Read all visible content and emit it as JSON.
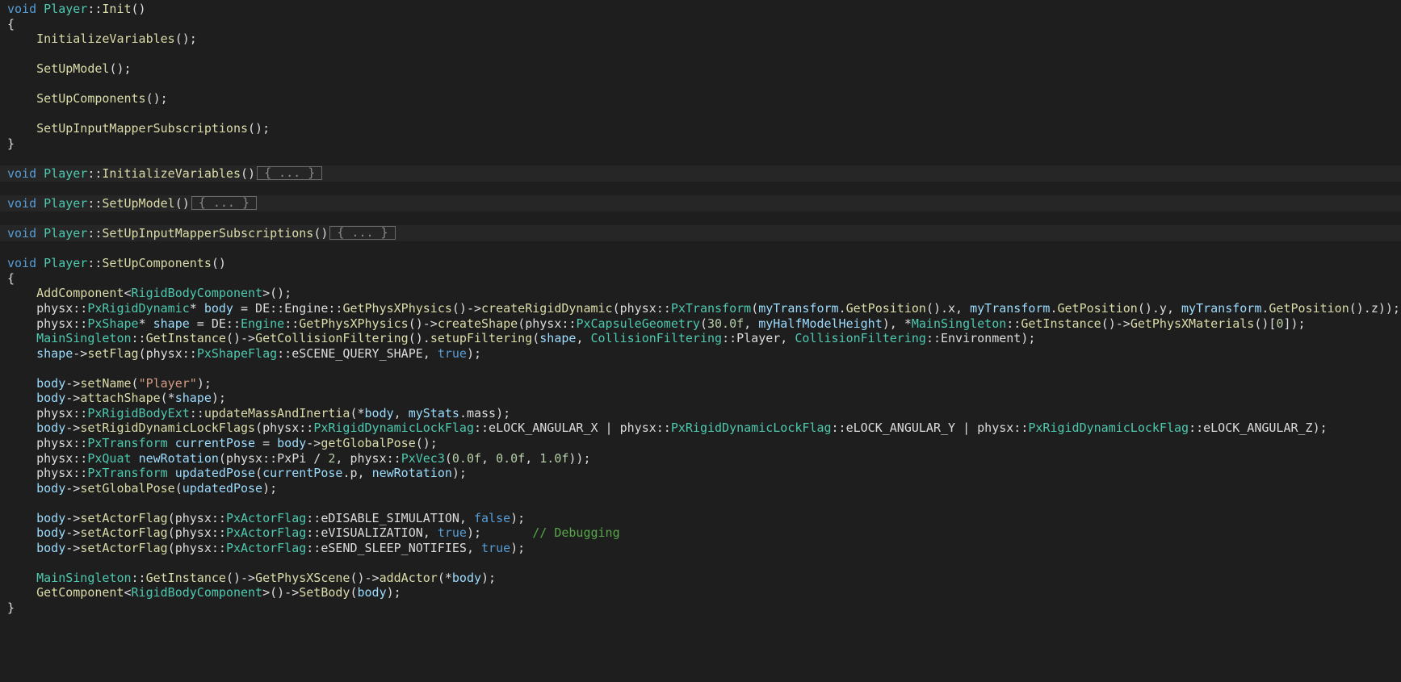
{
  "colors": {
    "background": "#1e1e1e",
    "keyword": "#569cd6",
    "type": "#4ec9b0",
    "function": "#dcdcaa",
    "plain": "#dcdcdc",
    "variable": "#9cdcfe",
    "number": "#b5cea8",
    "string": "#d69d85",
    "comment": "#57a64a"
  },
  "lines": [
    {
      "tokens": [
        [
          "kw",
          "void"
        ],
        [
          "pl",
          " "
        ],
        [
          "ty",
          "Player"
        ],
        [
          "pl",
          "::"
        ],
        [
          "fn",
          "Init"
        ],
        [
          "pl",
          "()"
        ]
      ]
    },
    {
      "tokens": [
        [
          "pl",
          "{"
        ]
      ]
    },
    {
      "tokens": [
        [
          "pl",
          "    "
        ],
        [
          "fn",
          "InitializeVariables"
        ],
        [
          "pl",
          "();"
        ]
      ]
    },
    {
      "tokens": []
    },
    {
      "tokens": [
        [
          "pl",
          "    "
        ],
        [
          "fn",
          "SetUpModel"
        ],
        [
          "pl",
          "();"
        ]
      ]
    },
    {
      "tokens": []
    },
    {
      "tokens": [
        [
          "pl",
          "    "
        ],
        [
          "fn",
          "SetUpComponents"
        ],
        [
          "pl",
          "();"
        ]
      ]
    },
    {
      "tokens": []
    },
    {
      "tokens": [
        [
          "pl",
          "    "
        ],
        [
          "fn",
          "SetUpInputMapperSubscriptions"
        ],
        [
          "pl",
          "();"
        ]
      ]
    },
    {
      "tokens": [
        [
          "pl",
          "}"
        ]
      ]
    },
    {
      "tokens": []
    },
    {
      "highlight": true,
      "fold": "{ ... }",
      "tokens": [
        [
          "kw",
          "void"
        ],
        [
          "pl",
          " "
        ],
        [
          "ty",
          "Player"
        ],
        [
          "pl",
          "::"
        ],
        [
          "fn",
          "InitializeVariables"
        ],
        [
          "pl",
          "()"
        ]
      ]
    },
    {
      "tokens": []
    },
    {
      "highlight": true,
      "fold": "{ ... }",
      "tokens": [
        [
          "kw",
          "void"
        ],
        [
          "pl",
          " "
        ],
        [
          "ty",
          "Player"
        ],
        [
          "pl",
          "::"
        ],
        [
          "fn",
          "SetUpModel"
        ],
        [
          "pl",
          "()"
        ]
      ]
    },
    {
      "tokens": []
    },
    {
      "highlight": true,
      "fold": "{ ... }",
      "tokens": [
        [
          "kw",
          "void"
        ],
        [
          "pl",
          " "
        ],
        [
          "ty",
          "Player"
        ],
        [
          "pl",
          "::"
        ],
        [
          "fn",
          "SetUpInputMapperSubscriptions"
        ],
        [
          "pl",
          "()"
        ]
      ]
    },
    {
      "tokens": []
    },
    {
      "tokens": [
        [
          "kw",
          "void"
        ],
        [
          "pl",
          " "
        ],
        [
          "ty",
          "Player"
        ],
        [
          "pl",
          "::"
        ],
        [
          "fn",
          "SetUpComponents"
        ],
        [
          "pl",
          "()"
        ]
      ]
    },
    {
      "tokens": [
        [
          "pl",
          "{"
        ]
      ]
    },
    {
      "tokens": [
        [
          "pl",
          "    "
        ],
        [
          "fn",
          "AddComponent"
        ],
        [
          "pl",
          "<"
        ],
        [
          "ty",
          "RigidBodyComponent"
        ],
        [
          "pl",
          ">();"
        ]
      ]
    },
    {
      "tokens": [
        [
          "pl",
          "    physx::"
        ],
        [
          "ty",
          "PxRigidDynamic"
        ],
        [
          "pl",
          "* "
        ],
        [
          "var",
          "body"
        ],
        [
          "pl",
          " = DE::Engine::"
        ],
        [
          "fn",
          "GetPhysXPhysics"
        ],
        [
          "pl",
          "()->"
        ],
        [
          "fn",
          "createRigidDynamic"
        ],
        [
          "pl",
          "(physx::"
        ],
        [
          "ty",
          "PxTransform"
        ],
        [
          "pl",
          "("
        ],
        [
          "var",
          "myTransform"
        ],
        [
          "pl",
          "."
        ],
        [
          "fn",
          "GetPosition"
        ],
        [
          "pl",
          "().x, "
        ],
        [
          "var",
          "myTransform"
        ],
        [
          "pl",
          "."
        ],
        [
          "fn",
          "GetPosition"
        ],
        [
          "pl",
          "().y, "
        ],
        [
          "var",
          "myTransform"
        ],
        [
          "pl",
          "."
        ],
        [
          "fn",
          "GetPosition"
        ],
        [
          "pl",
          "().z));"
        ]
      ]
    },
    {
      "tokens": [
        [
          "pl",
          "    physx::"
        ],
        [
          "ty",
          "PxShape"
        ],
        [
          "pl",
          "* "
        ],
        [
          "var",
          "shape"
        ],
        [
          "pl",
          " = DE::"
        ],
        [
          "ty",
          "Engine"
        ],
        [
          "pl",
          "::"
        ],
        [
          "fn",
          "GetPhysXPhysics"
        ],
        [
          "pl",
          "()->"
        ],
        [
          "fn",
          "createShape"
        ],
        [
          "pl",
          "(physx::"
        ],
        [
          "ty",
          "PxCapsuleGeometry"
        ],
        [
          "pl",
          "("
        ],
        [
          "num",
          "30.0f"
        ],
        [
          "pl",
          ", "
        ],
        [
          "var",
          "myHalfModelHeight"
        ],
        [
          "pl",
          "), *"
        ],
        [
          "ty",
          "MainSingleton"
        ],
        [
          "pl",
          "::"
        ],
        [
          "fn",
          "GetInstance"
        ],
        [
          "pl",
          "()->"
        ],
        [
          "fn",
          "GetPhysXMaterials"
        ],
        [
          "pl",
          "()["
        ],
        [
          "num",
          "0"
        ],
        [
          "pl",
          "]);"
        ]
      ]
    },
    {
      "tokens": [
        [
          "pl",
          "    "
        ],
        [
          "ty",
          "MainSingleton"
        ],
        [
          "pl",
          "::"
        ],
        [
          "fn",
          "GetInstance"
        ],
        [
          "pl",
          "()->"
        ],
        [
          "fn",
          "GetCollisionFiltering"
        ],
        [
          "pl",
          "()."
        ],
        [
          "fn",
          "setupFiltering"
        ],
        [
          "pl",
          "("
        ],
        [
          "var",
          "shape"
        ],
        [
          "pl",
          ", "
        ],
        [
          "ty",
          "CollisionFiltering"
        ],
        [
          "pl",
          "::Player, "
        ],
        [
          "ty",
          "CollisionFiltering"
        ],
        [
          "pl",
          "::Environment);"
        ]
      ]
    },
    {
      "tokens": [
        [
          "pl",
          "    "
        ],
        [
          "var",
          "shape"
        ],
        [
          "pl",
          "->"
        ],
        [
          "fn",
          "setFlag"
        ],
        [
          "pl",
          "(physx::"
        ],
        [
          "ty",
          "PxShapeFlag"
        ],
        [
          "pl",
          "::eSCENE_QUERY_SHAPE, "
        ],
        [
          "kw",
          "true"
        ],
        [
          "pl",
          ");"
        ]
      ]
    },
    {
      "tokens": []
    },
    {
      "tokens": [
        [
          "pl",
          "    "
        ],
        [
          "var",
          "body"
        ],
        [
          "pl",
          "->"
        ],
        [
          "fn",
          "setName"
        ],
        [
          "pl",
          "("
        ],
        [
          "str",
          "\"Player\""
        ],
        [
          "pl",
          ");"
        ]
      ]
    },
    {
      "tokens": [
        [
          "pl",
          "    "
        ],
        [
          "var",
          "body"
        ],
        [
          "pl",
          "->"
        ],
        [
          "fn",
          "attachShape"
        ],
        [
          "pl",
          "(*"
        ],
        [
          "var",
          "shape"
        ],
        [
          "pl",
          ");"
        ]
      ]
    },
    {
      "tokens": [
        [
          "pl",
          "    physx::"
        ],
        [
          "ty",
          "PxRigidBodyExt"
        ],
        [
          "pl",
          "::"
        ],
        [
          "fn",
          "updateMassAndInertia"
        ],
        [
          "pl",
          "(*"
        ],
        [
          "var",
          "body"
        ],
        [
          "pl",
          ", "
        ],
        [
          "var",
          "myStats"
        ],
        [
          "pl",
          ".mass);"
        ]
      ]
    },
    {
      "tokens": [
        [
          "pl",
          "    "
        ],
        [
          "var",
          "body"
        ],
        [
          "pl",
          "->"
        ],
        [
          "fn",
          "setRigidDynamicLockFlags"
        ],
        [
          "pl",
          "(physx::"
        ],
        [
          "ty",
          "PxRigidDynamicLockFlag"
        ],
        [
          "pl",
          "::eLOCK_ANGULAR_X | physx::"
        ],
        [
          "ty",
          "PxRigidDynamicLockFlag"
        ],
        [
          "pl",
          "::eLOCK_ANGULAR_Y | physx::"
        ],
        [
          "ty",
          "PxRigidDynamicLockFlag"
        ],
        [
          "pl",
          "::eLOCK_ANGULAR_Z);"
        ]
      ]
    },
    {
      "tokens": [
        [
          "pl",
          "    physx::"
        ],
        [
          "ty",
          "PxTransform"
        ],
        [
          "pl",
          " "
        ],
        [
          "var",
          "currentPose"
        ],
        [
          "pl",
          " = "
        ],
        [
          "var",
          "body"
        ],
        [
          "pl",
          "->"
        ],
        [
          "fn",
          "getGlobalPose"
        ],
        [
          "pl",
          "();"
        ]
      ]
    },
    {
      "tokens": [
        [
          "pl",
          "    physx::"
        ],
        [
          "ty",
          "PxQuat"
        ],
        [
          "pl",
          " "
        ],
        [
          "var",
          "newRotation"
        ],
        [
          "pl",
          "(physx::PxPi / "
        ],
        [
          "num",
          "2"
        ],
        [
          "pl",
          ", physx::"
        ],
        [
          "ty",
          "PxVec3"
        ],
        [
          "pl",
          "("
        ],
        [
          "num",
          "0.0f"
        ],
        [
          "pl",
          ", "
        ],
        [
          "num",
          "0.0f"
        ],
        [
          "pl",
          ", "
        ],
        [
          "num",
          "1.0f"
        ],
        [
          "pl",
          "));"
        ]
      ]
    },
    {
      "tokens": [
        [
          "pl",
          "    physx::"
        ],
        [
          "ty",
          "PxTransform"
        ],
        [
          "pl",
          " "
        ],
        [
          "var",
          "updatedPose"
        ],
        [
          "pl",
          "("
        ],
        [
          "var",
          "currentPose"
        ],
        [
          "pl",
          ".p, "
        ],
        [
          "var",
          "newRotation"
        ],
        [
          "pl",
          ");"
        ]
      ]
    },
    {
      "tokens": [
        [
          "pl",
          "    "
        ],
        [
          "var",
          "body"
        ],
        [
          "pl",
          "->"
        ],
        [
          "fn",
          "setGlobalPose"
        ],
        [
          "pl",
          "("
        ],
        [
          "var",
          "updatedPose"
        ],
        [
          "pl",
          ");"
        ]
      ]
    },
    {
      "tokens": []
    },
    {
      "tokens": [
        [
          "pl",
          "    "
        ],
        [
          "var",
          "body"
        ],
        [
          "pl",
          "->"
        ],
        [
          "fn",
          "setActorFlag"
        ],
        [
          "pl",
          "(physx::"
        ],
        [
          "ty",
          "PxActorFlag"
        ],
        [
          "pl",
          "::eDISABLE_SIMULATION, "
        ],
        [
          "kw",
          "false"
        ],
        [
          "pl",
          ");"
        ]
      ]
    },
    {
      "tokens": [
        [
          "pl",
          "    "
        ],
        [
          "var",
          "body"
        ],
        [
          "pl",
          "->"
        ],
        [
          "fn",
          "setActorFlag"
        ],
        [
          "pl",
          "(physx::"
        ],
        [
          "ty",
          "PxActorFlag"
        ],
        [
          "pl",
          "::eVISUALIZATION, "
        ],
        [
          "kw",
          "true"
        ],
        [
          "pl",
          ");       "
        ],
        [
          "cm",
          "// Debugging"
        ]
      ]
    },
    {
      "tokens": [
        [
          "pl",
          "    "
        ],
        [
          "var",
          "body"
        ],
        [
          "pl",
          "->"
        ],
        [
          "fn",
          "setActorFlag"
        ],
        [
          "pl",
          "(physx::"
        ],
        [
          "ty",
          "PxActorFlag"
        ],
        [
          "pl",
          "::eSEND_SLEEP_NOTIFIES, "
        ],
        [
          "kw",
          "true"
        ],
        [
          "pl",
          ");"
        ]
      ]
    },
    {
      "tokens": []
    },
    {
      "tokens": [
        [
          "pl",
          "    "
        ],
        [
          "ty",
          "MainSingleton"
        ],
        [
          "pl",
          "::"
        ],
        [
          "fn",
          "GetInstance"
        ],
        [
          "pl",
          "()->"
        ],
        [
          "fn",
          "GetPhysXScene"
        ],
        [
          "pl",
          "()->"
        ],
        [
          "fn",
          "addActor"
        ],
        [
          "pl",
          "(*"
        ],
        [
          "var",
          "body"
        ],
        [
          "pl",
          ");"
        ]
      ]
    },
    {
      "tokens": [
        [
          "pl",
          "    "
        ],
        [
          "fn",
          "GetComponent"
        ],
        [
          "pl",
          "<"
        ],
        [
          "ty",
          "RigidBodyComponent"
        ],
        [
          "pl",
          ">()->"
        ],
        [
          "fn",
          "SetBody"
        ],
        [
          "pl",
          "("
        ],
        [
          "var",
          "body"
        ],
        [
          "pl",
          ");"
        ]
      ]
    },
    {
      "tokens": [
        [
          "pl",
          "}"
        ]
      ]
    }
  ]
}
